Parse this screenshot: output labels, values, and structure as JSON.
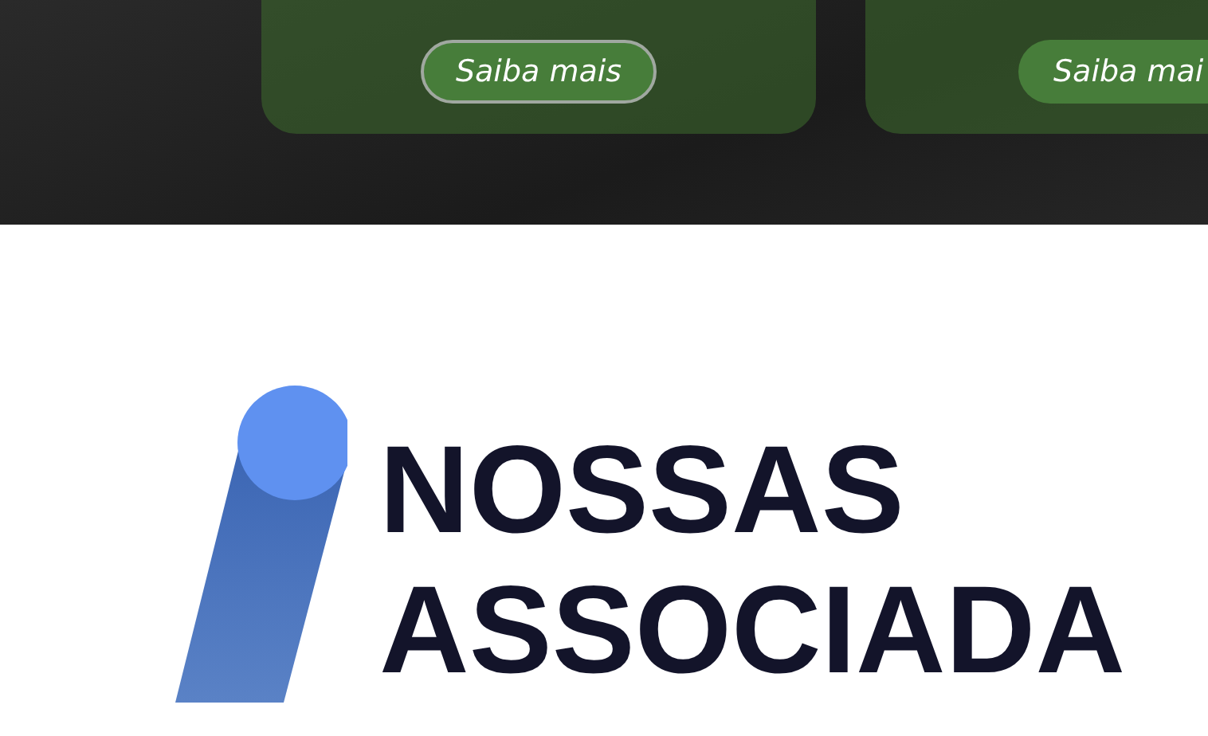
{
  "cards": [
    {
      "button": "Saiba mais",
      "outlined": true
    },
    {
      "button": "Saiba mai",
      "outlined": false
    }
  ],
  "section": {
    "heading": [
      "NOSSAS",
      "ASSOCIADA"
    ]
  }
}
